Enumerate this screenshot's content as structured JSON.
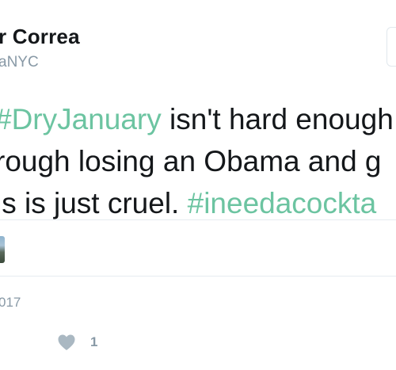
{
  "author": {
    "name": "r Correa",
    "handle": "aNYC"
  },
  "tweet": {
    "line1_hashtag": "#DryJanuary",
    "line1_text": " isn't hard enough",
    "line2_text": "rough losing an Obama and g",
    "line3_text": "is is just cruel. ",
    "line3_hashtag": "#ineedacockta",
    "hashtag_color": "#6cc4a1"
  },
  "meta": {
    "timestamp": "017"
  },
  "actions": {
    "like_icon": "heart-icon",
    "like_count": "1"
  },
  "colors": {
    "text": "#14171a",
    "muted": "#8899a6",
    "divider": "#e6ecf0"
  }
}
